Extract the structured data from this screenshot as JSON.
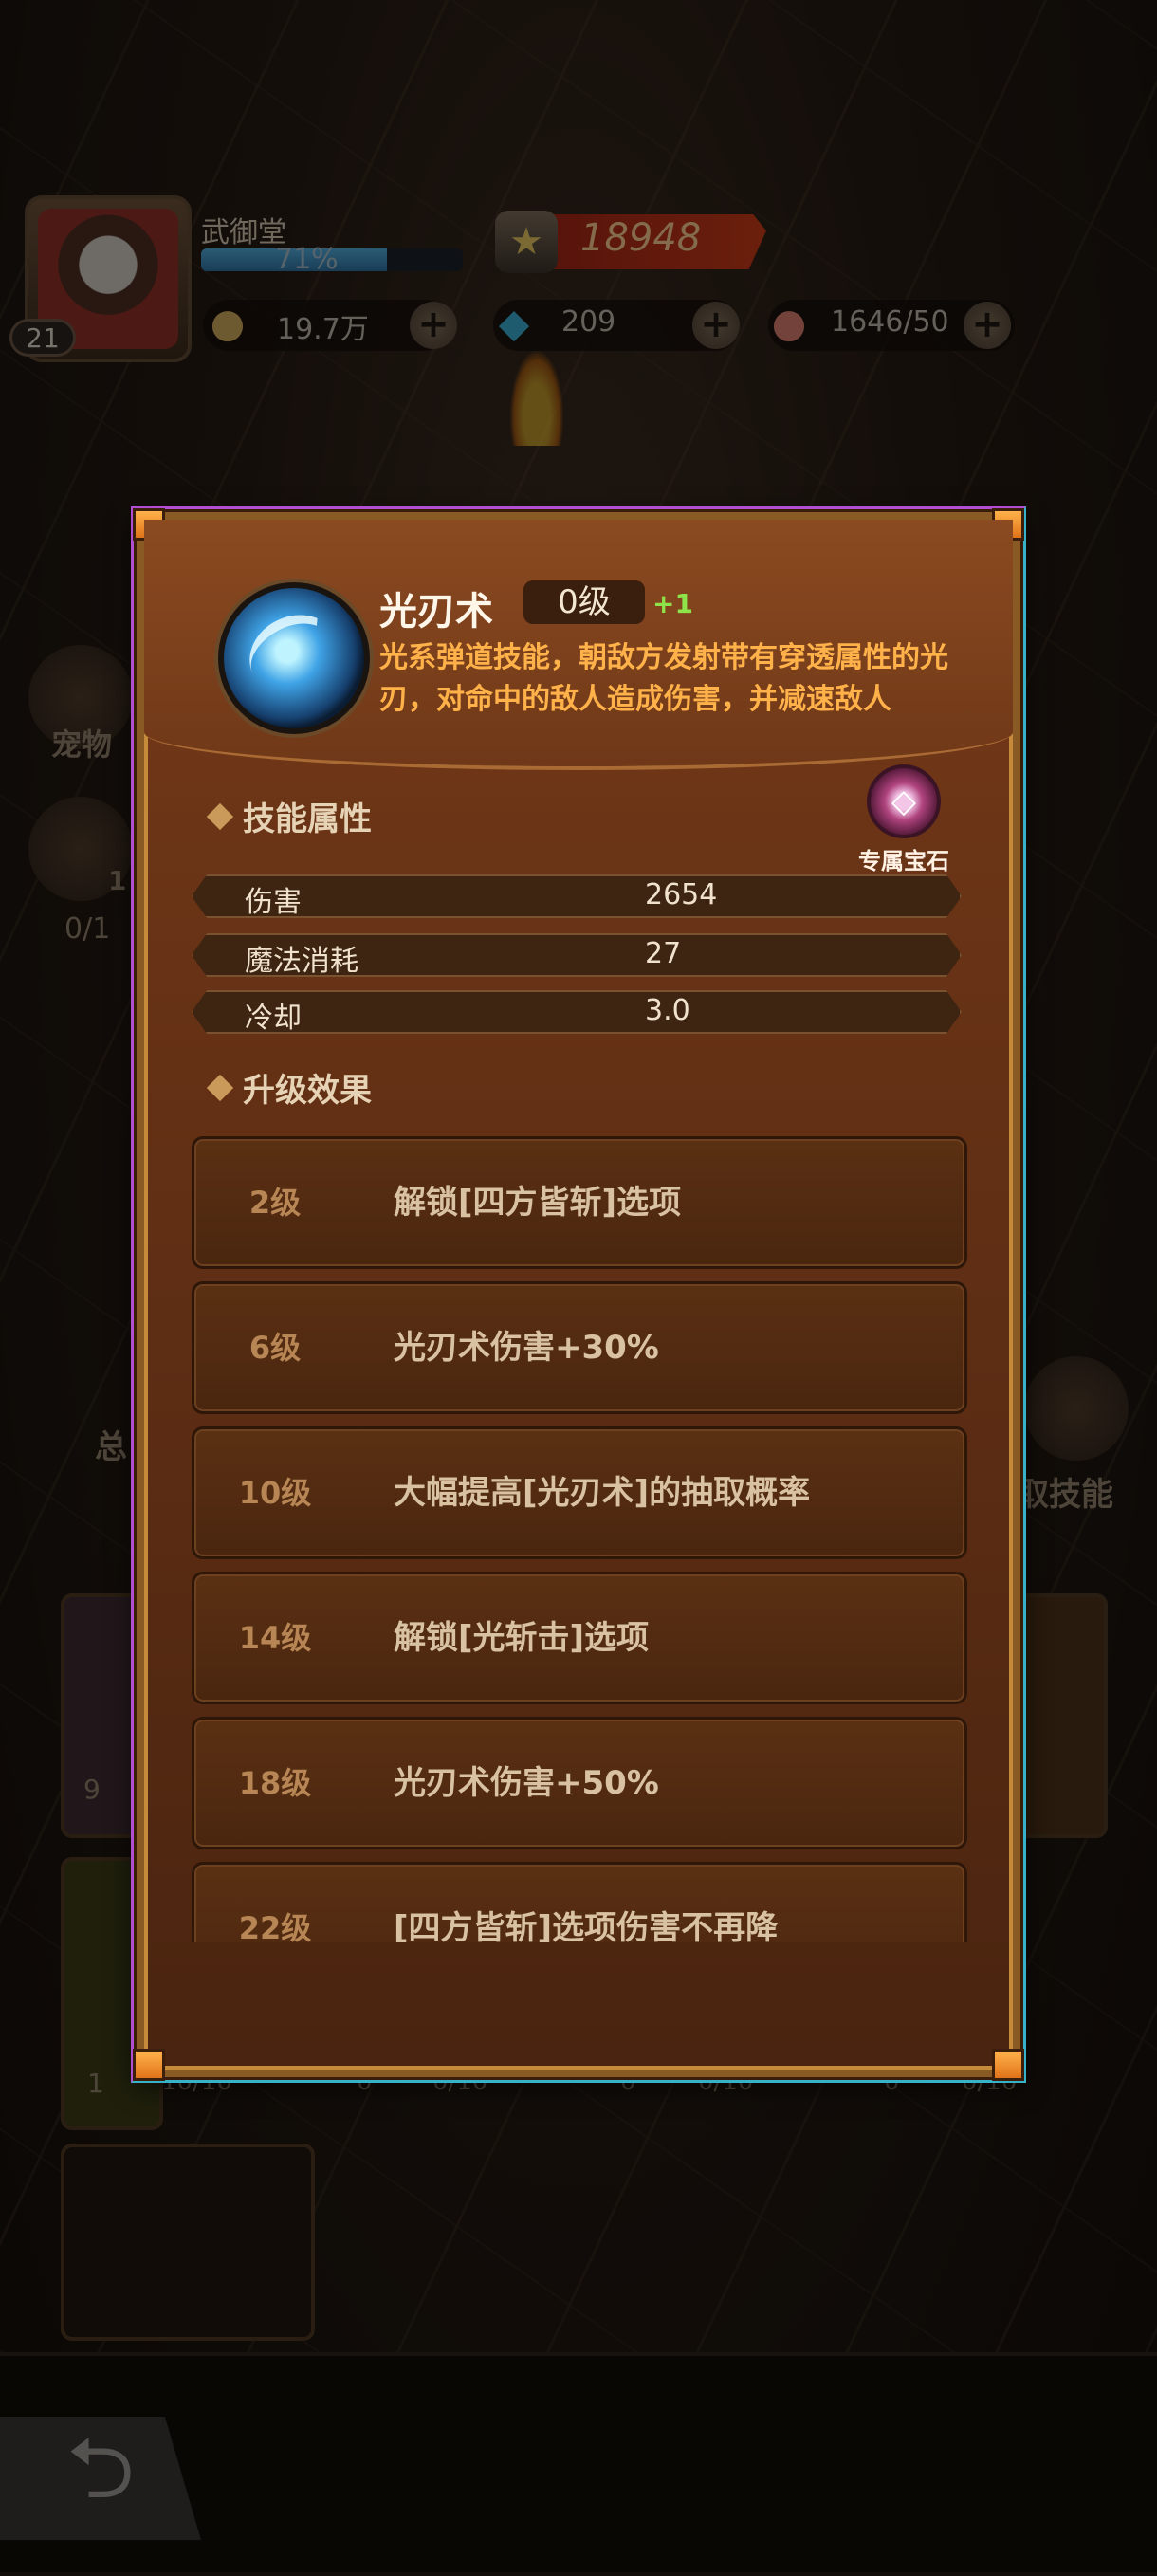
{
  "player": {
    "name": "武御堂",
    "level": "21",
    "exp_percent_text": "71%",
    "exp_fraction": 0.71,
    "power": "18948"
  },
  "resources": {
    "gold": "19.7万",
    "gems": "209",
    "stamina": "1646/50"
  },
  "background": {
    "pet_label": "宠物",
    "counter_a": "0/1",
    "counter_a_badge": "1",
    "skill_label": "取技能",
    "side_label": "总",
    "card_badge_a": "9",
    "card_badge_b": "1",
    "card_counter_a": "10/10",
    "card_counter_b": "0",
    "card_counter_c": "0/10"
  },
  "skill": {
    "name": "光刃术",
    "level": "0级",
    "level_bonus": "+1",
    "description": "光系弹道技能，朝敌方发射带有穿透属性的光刃，对命中的敌人造成伤害，并减速敌人"
  },
  "sections": {
    "attributes_title": "技能属性",
    "upgrade_title": "升级效果",
    "gem_label": "专属宝石"
  },
  "attributes": [
    {
      "name": "伤害",
      "value": "2654"
    },
    {
      "name": "魔法消耗",
      "value": "27"
    },
    {
      "name": "冷却",
      "value": "3.0"
    }
  ],
  "upgrades": [
    {
      "level": "2级",
      "text": "解锁[四方皆斩]选项"
    },
    {
      "level": "6级",
      "text": "光刃术伤害+30%"
    },
    {
      "level": "10级",
      "text": "大幅提高[光刃术]的抽取概率"
    },
    {
      "level": "14级",
      "text": "解锁[光斩击]选项"
    },
    {
      "level": "18级",
      "text": "光刃术伤害+50%"
    },
    {
      "level": "22级",
      "text": "[四方皆斩]选项伤害不再降"
    }
  ],
  "colors": {
    "accent_orange": "#ffb14a",
    "bonus_green": "#8ee34a",
    "panel_brown": "#6b3416"
  },
  "icons": [
    "shield-icon",
    "gold-coin-icon",
    "diamond-icon",
    "meat-icon",
    "plus-icon",
    "back-arrow-icon",
    "gem-icon",
    "diamond-bullet-icon"
  ]
}
